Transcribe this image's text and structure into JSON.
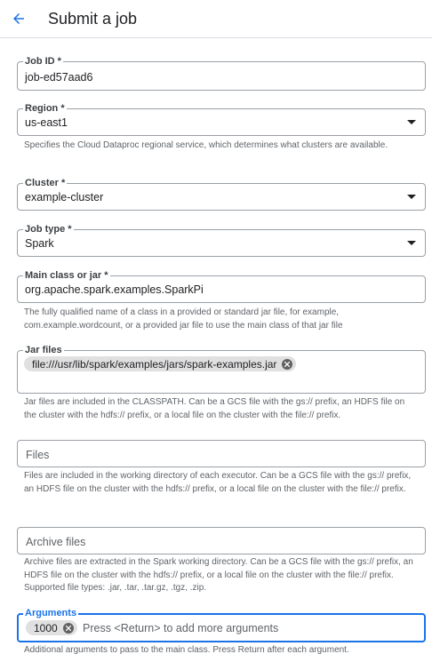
{
  "header": {
    "title": "Submit a job"
  },
  "job_id": {
    "label": "Job ID *",
    "value": "job-ed57aad6"
  },
  "region": {
    "label": "Region *",
    "value": "us-east1",
    "help": "Specifies the Cloud Dataproc regional service, which determines what clusters are available."
  },
  "cluster": {
    "label": "Cluster *",
    "value": "example-cluster"
  },
  "job_type": {
    "label": "Job type *",
    "value": "Spark"
  },
  "main_class": {
    "label": "Main class or jar *",
    "value": "org.apache.spark.examples.SparkPi",
    "help": "The fully qualified name of a class in a provided or standard jar file, for example, com.example.wordcount, or a provided jar file to use the main class of that jar file"
  },
  "jar_files": {
    "label": "Jar files",
    "chips": [
      "file:///usr/lib/spark/examples/jars/spark-examples.jar"
    ],
    "help": "Jar files are included in the CLASSPATH. Can be a GCS file with the gs:// prefix, an HDFS file on the cluster with the hdfs:// prefix, or a local file on the cluster with the file:// prefix."
  },
  "files": {
    "placeholder": "Files",
    "help": "Files are included in the working directory of each executor. Can be a GCS file with the gs:// prefix, an HDFS file on the cluster with the hdfs:// prefix, or a local file on the cluster with the file:// prefix."
  },
  "archive_files": {
    "placeholder": "Archive files",
    "help": "Archive files are extracted in the Spark working directory. Can be a GCS file with the gs:// prefix, an HDFS file on the cluster with the hdfs:// prefix, or a local file on the cluster with the file:// prefix. Supported file types: .jar, .tar, .tar.gz, .tgz, .zip."
  },
  "arguments": {
    "label": "Arguments",
    "chips": [
      "1000"
    ],
    "placeholder": "Press <Return> to add more arguments",
    "help": "Additional arguments to pass to the main class. Press Return after each argument."
  },
  "colors": {
    "accent": "#1a73e8",
    "border": "#9aa0a6",
    "chip": "#e0e0e0"
  }
}
